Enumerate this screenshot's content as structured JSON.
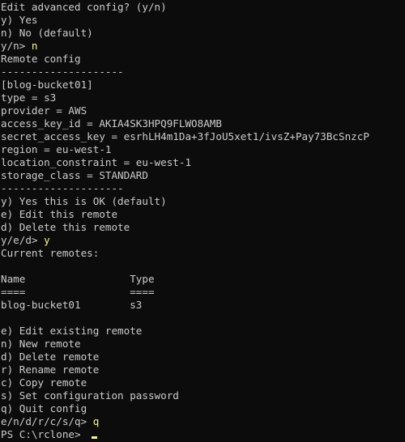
{
  "colors": {
    "background": "#0c0c0c",
    "text": "#cccccc",
    "user_input": "#f9f1a5"
  },
  "terminal": {
    "lines": [
      {
        "text": "Edit advanced config? (y/n)"
      },
      {
        "text": "y) Yes"
      },
      {
        "text": "n) No (default)"
      },
      {
        "text": "y/n> ",
        "input": "n"
      },
      {
        "text": "Remote config"
      },
      {
        "text": "--------------------"
      },
      {
        "text": "[blog-bucket01]"
      },
      {
        "text": "type = s3"
      },
      {
        "text": "provider = AWS"
      },
      {
        "text": "access_key_id = AKIA4SK3HPQ9FLWO8AMB"
      },
      {
        "text": "secret_access_key = esrhLH4m1Da+3fJoU5xet1/ivsZ+Pay73BcSnzcP"
      },
      {
        "text": "region = eu-west-1"
      },
      {
        "text": "location_constraint = eu-west-1"
      },
      {
        "text": "storage_class = STANDARD"
      },
      {
        "text": "--------------------"
      },
      {
        "text": "y) Yes this is OK (default)"
      },
      {
        "text": "e) Edit this remote"
      },
      {
        "text": "d) Delete this remote"
      },
      {
        "text": "y/e/d> ",
        "input": "y"
      },
      {
        "text": "Current remotes:"
      },
      {
        "text": ""
      },
      {
        "text": "Name                 Type"
      },
      {
        "text": "====                 ===="
      },
      {
        "text": "blog-bucket01        s3"
      },
      {
        "text": ""
      },
      {
        "text": "e) Edit existing remote"
      },
      {
        "text": "n) New remote"
      },
      {
        "text": "d) Delete remote"
      },
      {
        "text": "r) Rename remote"
      },
      {
        "text": "c) Copy remote"
      },
      {
        "text": "s) Set configuration password"
      },
      {
        "text": "q) Quit config"
      },
      {
        "text": "e/n/d/r/c/s/q> ",
        "input": "q"
      },
      {
        "text": "PS C:\\rclone> ",
        "cursor": true
      }
    ]
  }
}
